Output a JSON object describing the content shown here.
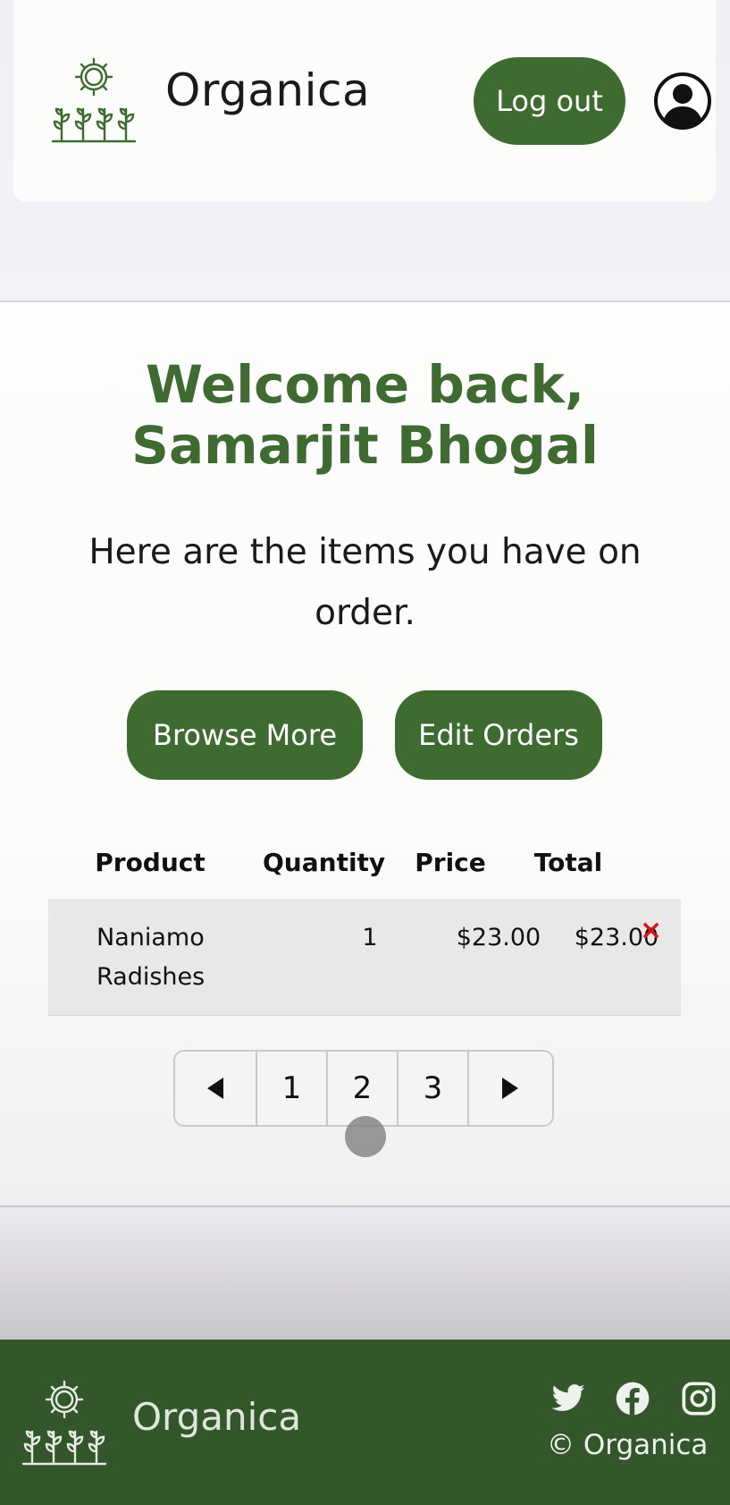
{
  "header": {
    "brand": "Organica",
    "logout_label": "Log out",
    "logo_icon": "sun-sprouts-icon",
    "account_icon": "user-circle-icon"
  },
  "welcome": {
    "line1": "Welcome back,",
    "line2": "Samarjit Bhogal",
    "subtitle_line1": "Here are the items you have on",
    "subtitle_line2": "order."
  },
  "actions": {
    "browse_label": "Browse More",
    "edit_label": "Edit Orders"
  },
  "orders": {
    "columns": [
      "Product",
      "Quantity",
      "Price",
      "Total"
    ],
    "rows": [
      {
        "product_line1": "Naniamo",
        "product_line2": "Radishes",
        "quantity": "1",
        "price": "$23.00",
        "total": "$23.00",
        "remove_symbol": "×"
      }
    ]
  },
  "pagination": {
    "prev_icon": "caret-left-icon",
    "next_icon": "caret-right-icon",
    "pages": [
      "1",
      "2",
      "3"
    ]
  },
  "footer": {
    "brand": "Organica",
    "copyright": "© Organica",
    "social_icons": [
      "twitter-icon",
      "facebook-icon",
      "instagram-icon"
    ]
  },
  "colors": {
    "brand_green": "#3e6b30",
    "footer_green": "#33572a",
    "remove_red": "#d41616"
  }
}
